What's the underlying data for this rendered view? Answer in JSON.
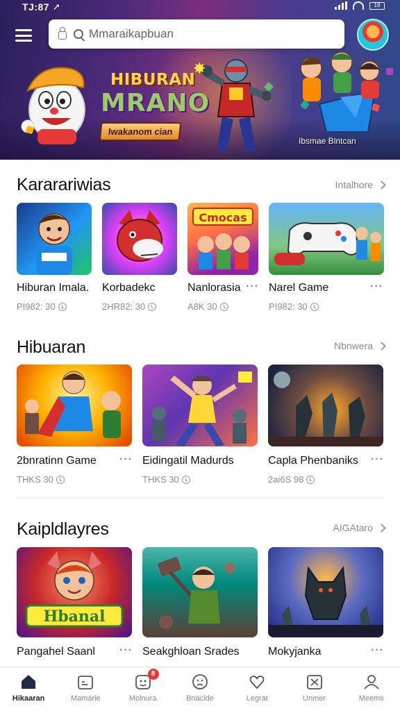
{
  "status_bar": {
    "time": "TJ:87",
    "battery": "18"
  },
  "search": {
    "placeholder": "Mmaraikapbuan"
  },
  "hero": {
    "title_line1": "HIBURAN",
    "title_line2": "MRANO",
    "subtitle": "Iwakanom cian",
    "caption": "Ibsmae Blntcan"
  },
  "sections": [
    {
      "title": "Kararariwias",
      "more": "Intalhore",
      "cards": [
        {
          "title": "Hiburan Imala.",
          "meta": "PI982: 30"
        },
        {
          "title": "Korbadekc",
          "meta": "2HR82: 30"
        },
        {
          "title": "Nanlorasia",
          "meta": "A8K 30"
        },
        {
          "title": "Narel Game",
          "meta": "PI982: 30"
        }
      ]
    },
    {
      "title": "Hibuaran",
      "more": "Nbnwera",
      "cards": [
        {
          "title": "2bnratinn Game",
          "meta": "THKS 30"
        },
        {
          "title": "Eidingatil Madurds",
          "meta": "THKS 30"
        },
        {
          "title": "Capla Phenbaniks",
          "meta": "2ai6S 98"
        }
      ]
    },
    {
      "title": "Kaipldlayres",
      "more": "AIGAtaro",
      "cards": [
        {
          "title": "Pangahel Saanl",
          "meta": ""
        },
        {
          "title": "Seakghloan Srades",
          "meta": ""
        },
        {
          "title": "Mokyjanka",
          "meta": ""
        }
      ]
    }
  ],
  "bottom_nav": [
    {
      "label": "Hikaaran",
      "icon": "home-icon",
      "active": true
    },
    {
      "label": "Mamarie",
      "icon": "calendar-icon"
    },
    {
      "label": "Molnura",
      "icon": "smiley-icon",
      "badge": "8"
    },
    {
      "label": "Bnacide",
      "icon": "face-icon"
    },
    {
      "label": "Legrat",
      "icon": "heart-icon"
    },
    {
      "label": "Unmer",
      "icon": "close-box-icon"
    },
    {
      "label": "Meems",
      "icon": "profile-icon"
    }
  ],
  "colors": {
    "accent": "#e53935",
    "hero_start": "#2a1f5a",
    "hero_end": "#2e4a8a"
  }
}
